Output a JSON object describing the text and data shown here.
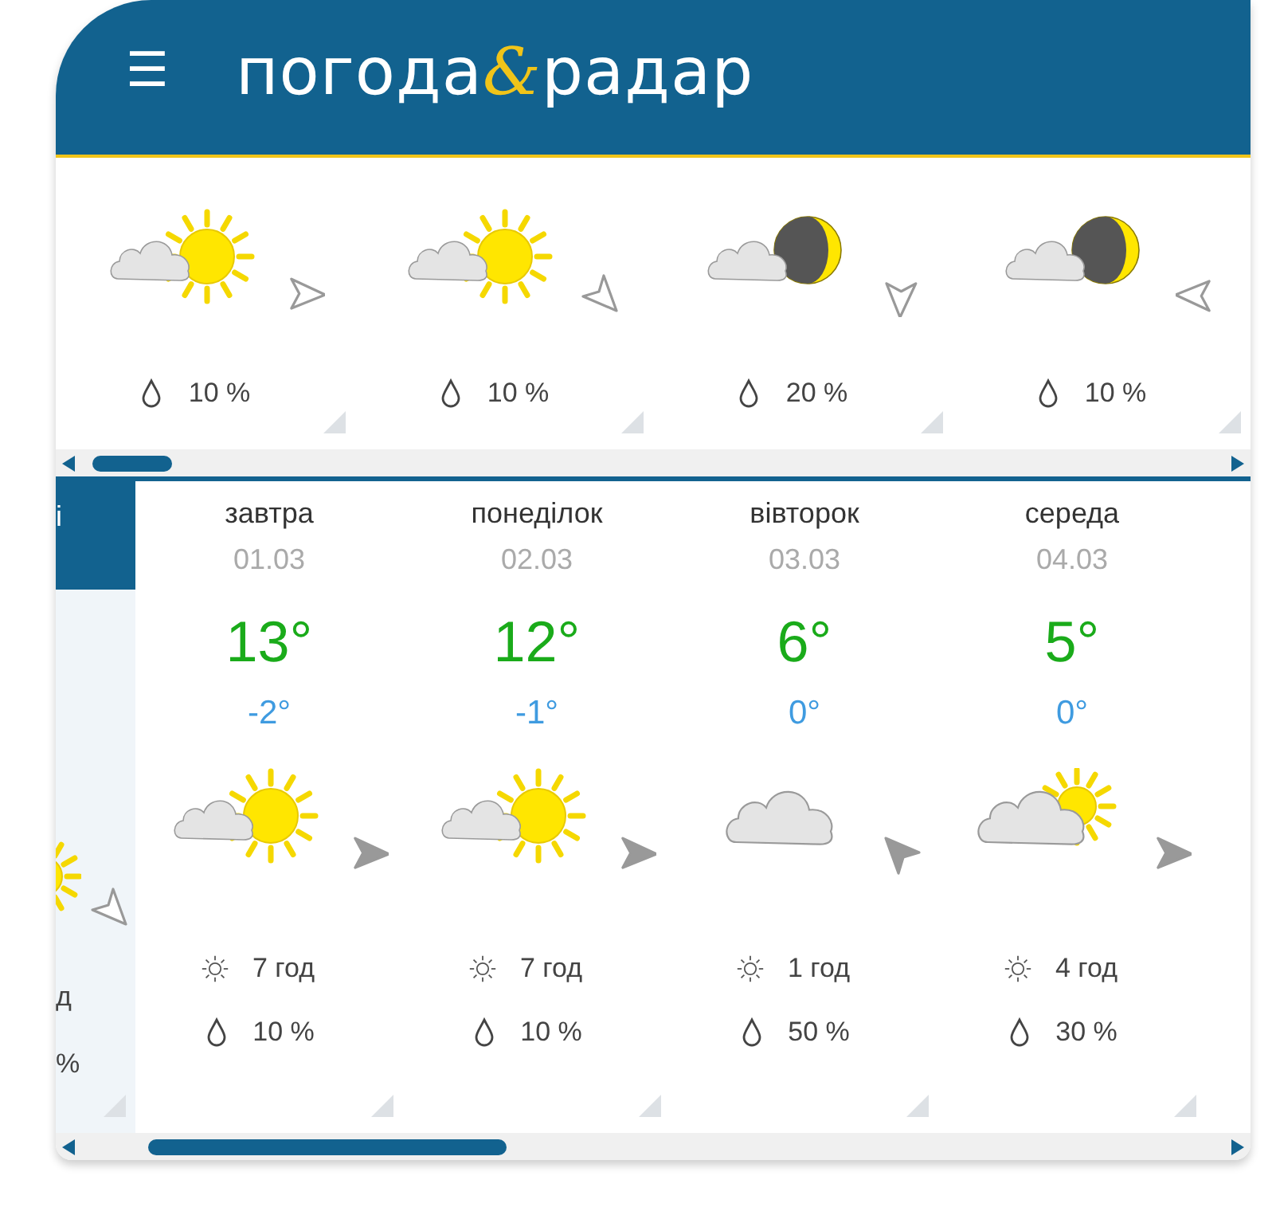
{
  "header": {
    "menu_icon": "☰",
    "logo": {
      "first": "погода",
      "mark": "&",
      "second": "радар"
    }
  },
  "hourly": [
    {
      "kind": "sun-cloud",
      "wind": {
        "kind": "east",
        "filled": false
      },
      "precip": "10 %"
    },
    {
      "kind": "sun-cloud",
      "wind": {
        "kind": "southeast",
        "filled": false
      },
      "precip": "10 %"
    },
    {
      "kind": "moon-cloud",
      "wind": {
        "kind": "south",
        "filled": false
      },
      "precip": "20 %"
    },
    {
      "kind": "moon-cloud",
      "wind": {
        "kind": "west",
        "filled": false
      },
      "precip": "10 %"
    }
  ],
  "pinned_column": {
    "header": "і",
    "kind": "sun",
    "wind": {
      "kind": "southeast",
      "filled": false
    },
    "sun_hours": "д",
    "precip": "%"
  },
  "days": [
    {
      "name": "завтра",
      "date": "01.03",
      "high": "13°",
      "low": "-2°",
      "kind": "sun-cloud",
      "wind": {
        "kind": "east",
        "filled": true
      },
      "sun_hours": "7 год",
      "precip": "10 %"
    },
    {
      "name": "понеділок",
      "date": "02.03",
      "high": "12°",
      "low": "-1°",
      "kind": "sun-cloud",
      "wind": {
        "kind": "east",
        "filled": true
      },
      "sun_hours": "7 год",
      "precip": "10 %"
    },
    {
      "name": "вівторок",
      "date": "03.03",
      "high": "6°",
      "low": "0°",
      "kind": "cloud",
      "wind": {
        "kind": "northwest",
        "filled": true
      },
      "sun_hours": "1 год",
      "precip": "50 %"
    },
    {
      "name": "середа",
      "date": "04.03",
      "high": "5°",
      "low": "0°",
      "kind": "cloud-sun",
      "wind": {
        "kind": "east",
        "filled": true
      },
      "sun_hours": "4 год",
      "precip": "30 %"
    }
  ]
}
